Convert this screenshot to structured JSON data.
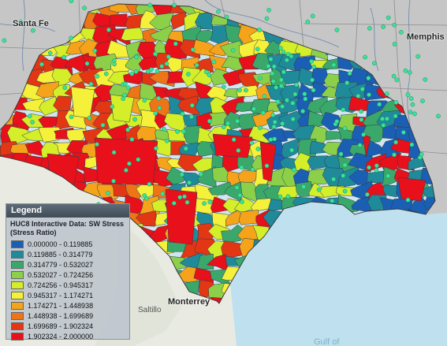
{
  "map": {
    "cities": {
      "santa_fe": "Santa Fe",
      "memphis": "Memphis",
      "monterrey": "Monterrey",
      "saltillo": "Saltillo",
      "gulf": "Gulf of"
    },
    "colors": {
      "water": "#cfe6ee",
      "gulf": "#bfe0ee",
      "land": "#e9ebe3",
      "outside_region": "#c6c6c6",
      "state_border": "#8d8d8d",
      "river": "#5e7fa8",
      "gauge_point": "#39e39b"
    }
  },
  "legend": {
    "header": "Legend",
    "title": "HUC8 Interactive Data: SW Stress (Stress Ratio)",
    "classes": [
      {
        "label": "0.000000 - 0.119885",
        "color": "#1a5fb4"
      },
      {
        "label": "0.119885 - 0.314779",
        "color": "#1f8a9a"
      },
      {
        "label": "0.314779 - 0.532027",
        "color": "#3aa86a"
      },
      {
        "label": "0.532027 - 0.724256",
        "color": "#8cd04a"
      },
      {
        "label": "0.724256 - 0.945317",
        "color": "#d4ee2a"
      },
      {
        "label": "0.945317 - 1.174271",
        "color": "#f5f03a"
      },
      {
        "label": "1.174271 - 1.448938",
        "color": "#f5a31a"
      },
      {
        "label": "1.448938 - 1.699689",
        "color": "#ee7418"
      },
      {
        "label": "1.699689 - 1.902324",
        "color": "#e23614"
      },
      {
        "label": "1.902324 - 2.000000",
        "color": "#e8101a"
      }
    ]
  }
}
